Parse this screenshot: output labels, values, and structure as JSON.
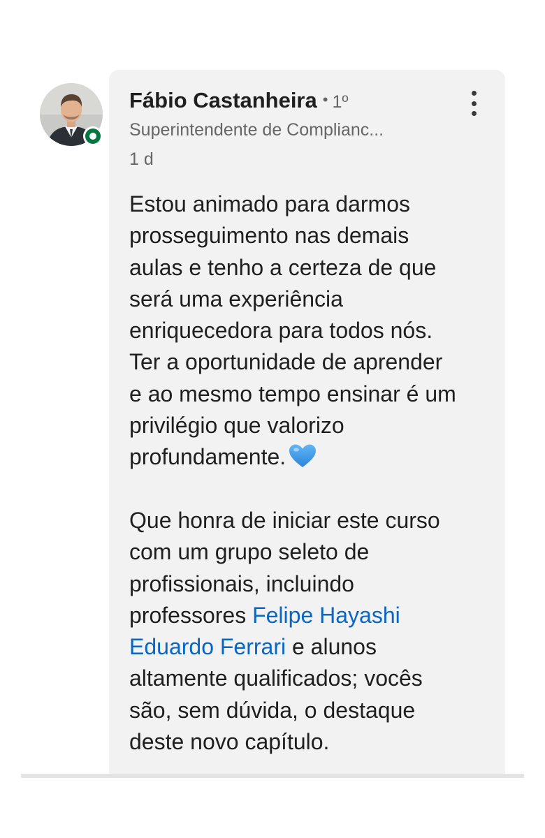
{
  "comment": {
    "author_name": "Fábio Castanheira",
    "separator": "•",
    "connection_degree": "1º",
    "headline": "Superintendente de Complianc...",
    "timestamp": "1 d",
    "paragraph1": {
      "lines": [
        "Estou animado para darmos",
        "prosseguimento nas demais",
        "aulas e tenho a certeza de que",
        "será uma experiência",
        "enriquecedora para todos nós.",
        "Ter a oportunidade de aprender",
        "e ao mesmo tempo ensinar é um",
        "privilégio que valorizo",
        "profundamente."
      ]
    },
    "paragraph2": {
      "lines": [
        "Que honra de iniciar este curso",
        "com um grupo seleto de",
        "profissionais, incluindo"
      ],
      "line4_prefix": "professores ",
      "mention1": "Felipe Hayashi",
      "mention2": "Eduardo Ferrari",
      "line5_suffix": " e alunos",
      "lines_after": [
        "altamente qualificados; vocês",
        "são, sem dúvida, o destaque",
        "deste novo capítulo."
      ]
    },
    "heart_emoji_color": "#3a97e8",
    "mention_color": "#0a66c2",
    "presence_status_color": "#057642"
  }
}
